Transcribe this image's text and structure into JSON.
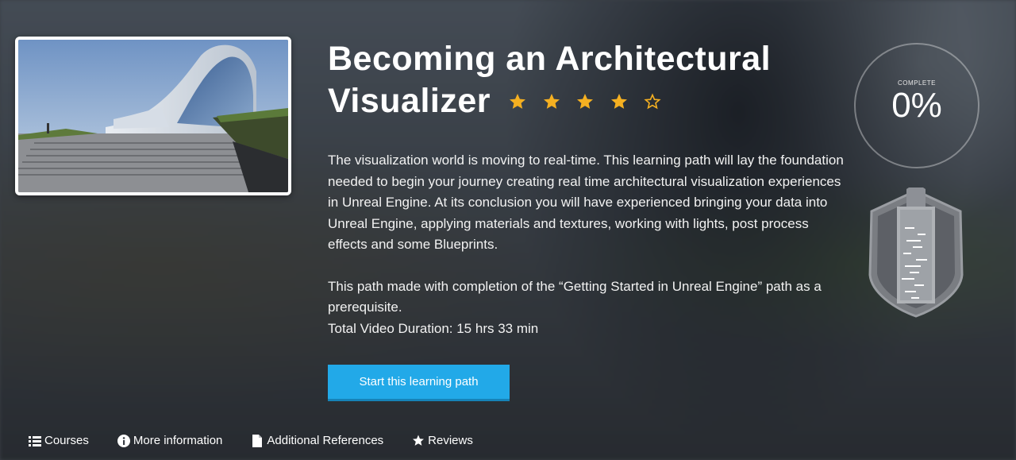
{
  "course": {
    "title_line1": "Becoming an Architectural",
    "title_line2": "Visualizer",
    "rating": {
      "value": 4,
      "max": 5,
      "color": "#f5b021"
    },
    "description": [
      "The visualization world is moving to real-time. This learning path will lay the foundation needed to begin your journey creating real time architectural visualization experiences in Unreal Engine. At its conclusion you will have experienced bringing your data into Unreal Engine, applying materials and textures, working with lights, post process effects and some Blueprints.",
      "This path made with completion of the “Getting Started in Unreal Engine” path as a prerequisite."
    ],
    "duration": "Total Video Duration: 15 hrs 33 min",
    "start_button": "Start this learning path",
    "accent_color": "#22a9e8"
  },
  "progress": {
    "label": "COMPLETE",
    "value": "0%",
    "fraction": 0
  },
  "tabs": [
    {
      "label": "Courses",
      "icon": "list-icon"
    },
    {
      "label": "More information",
      "icon": "info-icon"
    },
    {
      "label": "Additional References",
      "icon": "file-icon"
    },
    {
      "label": "Reviews",
      "icon": "star-icon"
    }
  ]
}
